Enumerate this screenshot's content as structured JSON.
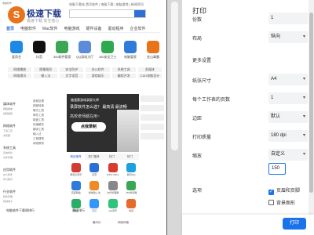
{
  "preview": {
    "hotline": "电脑下载站 首页软件 | 电脑下载 | 电脑游戏 | 新闻资讯",
    "corner_text": "电脑软件",
    "logo_char": "S",
    "logo_title": "极速下载",
    "logo_tagline": "极速下载  安全放心",
    "nav": [
      "首页",
      "电脑软件",
      "Mac软件",
      "电脑游戏",
      "硬件设备",
      "驱动程序",
      "企业软件"
    ],
    "apps": [
      {
        "label": "爱奇艺",
        "color": "#1e88e5"
      },
      {
        "label": "抖音",
        "color": "#111111"
      },
      {
        "label": "360软件管家",
        "color": "#3aa757"
      },
      {
        "label": "QQ游戏大厅",
        "color": "#5b8bd9"
      },
      {
        "label": "360安全卫士",
        "color": "#2ea94f"
      },
      {
        "label": "电脑管家",
        "color": "#2f7bd9"
      },
      {
        "label": "金山毒霸",
        "color": "#e8731a"
      }
    ],
    "tags": [
      "网络播放",
      "图像图形",
      "安全防护",
      "办公软件",
      "系统工具",
      "多媒体",
      "网络通讯",
      "输入法",
      "文字语音",
      "游戏娱乐",
      "编程开发",
      "CAD电脑设计"
    ],
    "side_categories": [
      {
        "cat": "媒体软件",
        "subs": [
          "网络播放",
          "视频编辑"
        ]
      },
      {
        "cat": "网络软件",
        "subs": [
          "下载工具",
          "浏览器"
        ]
      },
      {
        "cat": "系统工具",
        "subs": [
          "系统优化",
          "文件管理"
        ]
      },
      {
        "cat": "应用软件",
        "subs": [
          "办公软件",
          "学习教育"
        ]
      },
      {
        "cat": "行业软件",
        "subs": [
          "财务管理",
          "机械电子"
        ]
      }
    ],
    "mid_list": [
      "音频处理",
      "视频转换",
      "聊天工具",
      "邮件工具",
      "磁盘工具",
      "压缩解压",
      "翻译工具",
      "输入法",
      "工程建筑",
      "网络教育"
    ],
    "promo": {
      "top": "路速赛游戏录屏大师",
      "question": "录屏软件怎么选？ 最高清 最流畅",
      "subtitle": "高校老师都在用~",
      "button": "点我录制"
    },
    "tabs": [
      "精品推荐",
      "热门推荐",
      "热门",
      "热门"
    ],
    "grid_apps": [
      {
        "label": "网易云音乐",
        "color": "#d33a31"
      },
      {
        "label": "迅雷",
        "color": "#2b6fd6"
      },
      {
        "label": "WPS Office",
        "color": "#d83b2f"
      },
      {
        "label": "腾讯QQ",
        "color": "#1aa1e0"
      },
      {
        "label": "百度网盘",
        "color": "#2f7bd9"
      },
      {
        "label": "搜狗输入法",
        "color": "#f08a24"
      },
      {
        "label": "文件管理器",
        "color": "#888888"
      },
      {
        "label": "360浏览器",
        "color": "#3aa757"
      },
      {
        "label": "微信",
        "color": "#2aae67"
      },
      {
        "label": "钉钉",
        "color": "#3296fa"
      },
      {
        "label": "QQ音乐",
        "color": "#31c27c"
      },
      {
        "label": "快压",
        "color": "#e36b2c"
      }
    ],
    "bottom_left_title": "电脑软件下载周排行",
    "bottom_right_title": "最佳排行",
    "bottom_sub": "糖可乐",
    "bottom_sub2": "网络传输"
  },
  "print": {
    "title": "打印",
    "rows": [
      {
        "label": "份数",
        "value": "1",
        "dropdown": false
      },
      {
        "label": "布局",
        "value": "纵向",
        "dropdown": true
      }
    ],
    "more_settings": "更多设置",
    "more_rows": [
      {
        "label": "纸张尺寸",
        "value": "A4",
        "dropdown": true
      },
      {
        "label": "每个工作表的页数",
        "value": "1",
        "dropdown": true
      },
      {
        "label": "边距",
        "value": "默认",
        "dropdown": true
      },
      {
        "label": "打印质量",
        "value": "180 dpi",
        "dropdown": true
      },
      {
        "label": "缩放",
        "value": "自定义",
        "dropdown": true
      }
    ],
    "scale_value": "150",
    "options_label": "选项",
    "options": [
      {
        "label": "页眉和页脚",
        "checked": true
      },
      {
        "label": "背景图形",
        "checked": false
      }
    ],
    "print_button": "打印",
    "accent": "#1a73e8"
  }
}
